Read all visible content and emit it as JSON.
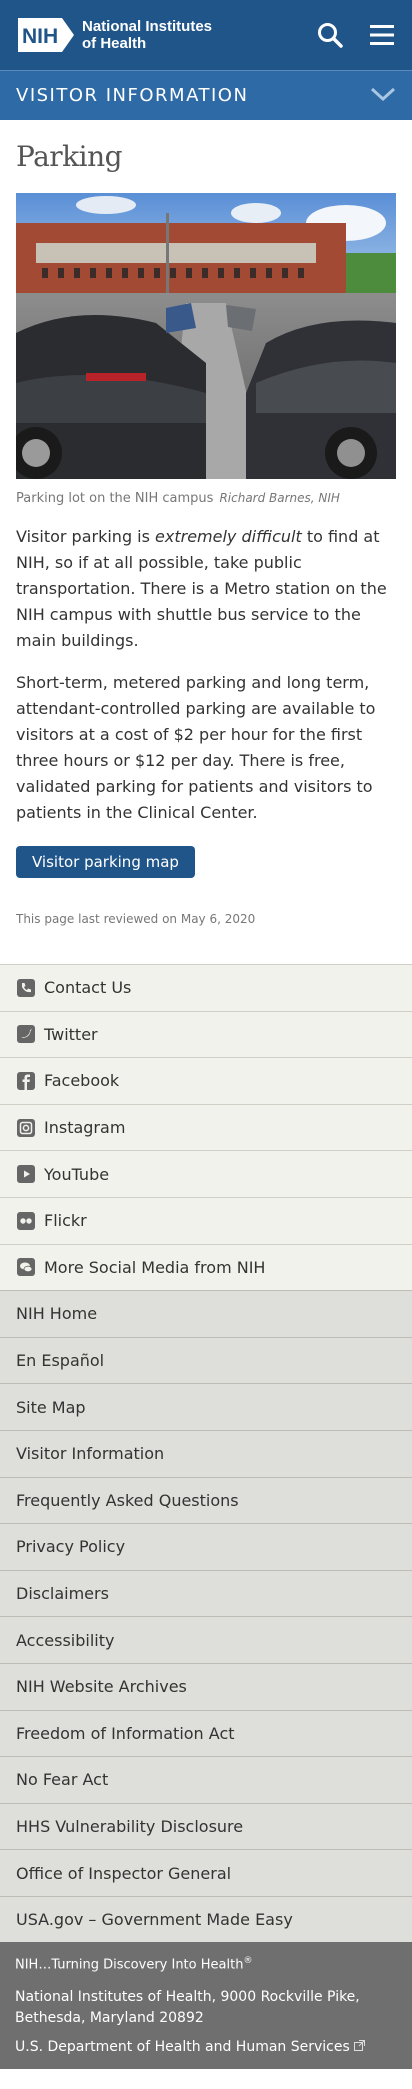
{
  "header": {
    "logo_abbr": "NIH",
    "logo_line1": "National Institutes",
    "logo_line2": "of Health",
    "section_label": "VISITOR INFORMATION"
  },
  "main": {
    "title": "Parking",
    "image_caption": "Parking lot on the NIH campus",
    "image_credit": "Richard Barnes, NIH",
    "para1_before": "Visitor parking is ",
    "para1_em": "extremely difficult",
    "para1_after": " to find at NIH, so if at all possible, take public transportation. There is a Metro station on the NIH campus with shuttle bus service to the main buildings.",
    "para2": "Short-term, metered parking and long term, attendant-controlled parking are available to visitors at a cost of $2 per hour for the first three hours or $12 per day. There is free, validated parking for patients and visitors to patients in the Clinical Center.",
    "button_label": "Visitor parking map",
    "reviewed": "This page last reviewed on May 6, 2020"
  },
  "social": [
    {
      "label": "Contact Us",
      "icon": "phone-icon"
    },
    {
      "label": "Twitter",
      "icon": "twitter-icon"
    },
    {
      "label": "Facebook",
      "icon": "facebook-icon"
    },
    {
      "label": "Instagram",
      "icon": "instagram-icon"
    },
    {
      "label": "YouTube",
      "icon": "youtube-icon"
    },
    {
      "label": "Flickr",
      "icon": "flickr-icon"
    },
    {
      "label": "More Social Media from NIH",
      "icon": "chat-bubbles-icon"
    }
  ],
  "links": [
    "NIH Home",
    "En Español",
    "Site Map",
    "Visitor Information",
    "Frequently Asked Questions",
    "Privacy Policy",
    "Disclaimers",
    "Accessibility",
    "NIH Website Archives",
    "Freedom of Information Act",
    "No Fear Act",
    "HHS Vulnerability Disclosure",
    "Office of Inspector General",
    "USA.gov – Government Made Easy"
  ],
  "bottom": {
    "tagline": "NIH…Turning Discovery Into Health",
    "tagline_mark": "®",
    "address": "National Institutes of Health, 9000 Rockville Pike, Bethesda, Maryland 20892",
    "hhs": "U.S. Department of Health and Human Services"
  },
  "colors": {
    "header_bg": "#20558a",
    "section_bg": "#2e6aa6",
    "button_bg": "#20558a",
    "footer_bg": "#6f6f6f"
  }
}
